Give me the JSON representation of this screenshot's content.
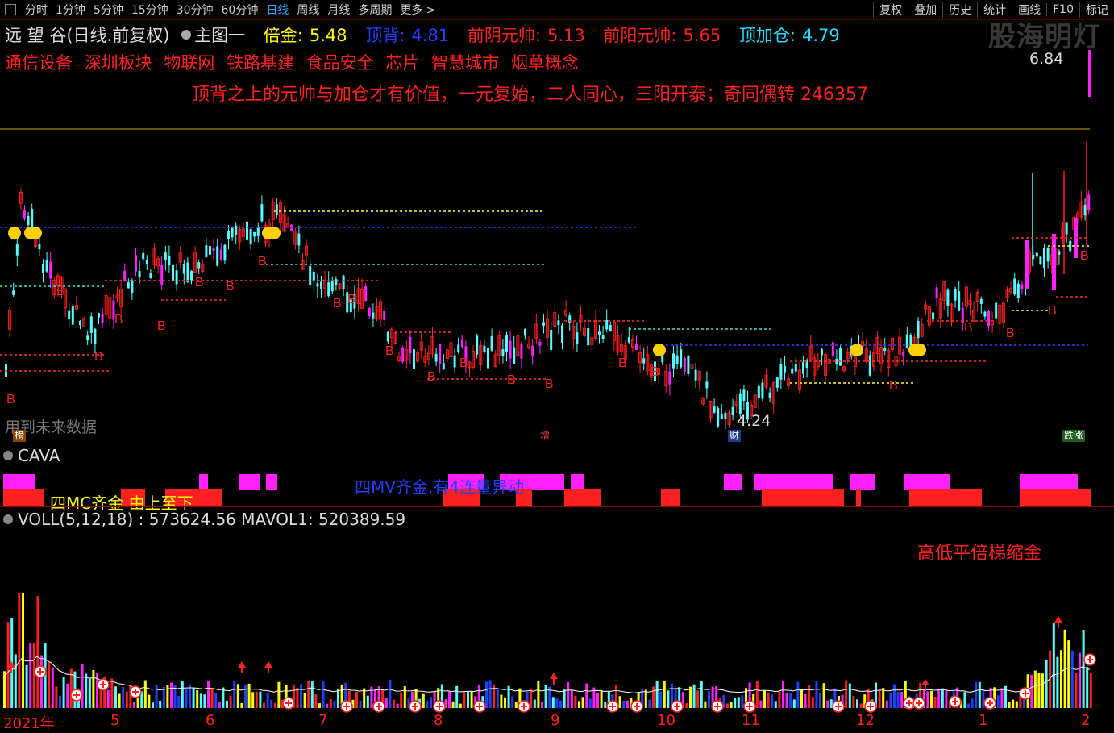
{
  "toolbar": {
    "items": [
      "分时",
      "1分钟",
      "5分钟",
      "15分钟",
      "30分钟",
      "60分钟",
      "日线",
      "周线",
      "月线",
      "多周期",
      "更多 >"
    ],
    "active": "日线",
    "right_items": [
      "复权",
      "叠加",
      "历史",
      "统计",
      "画线",
      "F10",
      "标记"
    ]
  },
  "watermark": "股海明灯",
  "header": {
    "stock": "远 望 谷(日线.前复权)",
    "main_chart": "主图一",
    "indicators": [
      {
        "label": "倍金:",
        "value": "5.48",
        "color": "#ffff00"
      },
      {
        "label": "顶背:",
        "value": "4.81",
        "color": "#2040ff"
      },
      {
        "label": "前阴元帅:",
        "value": "5.13",
        "color": "#ff2020"
      },
      {
        "label": "前阳元帅:",
        "value": "5.65",
        "color": "#ff2020"
      },
      {
        "label": "顶加仓:",
        "value": "4.79",
        "color": "#22ddff"
      }
    ]
  },
  "concepts": [
    "通信设备",
    "深圳板块",
    "物联网",
    "铁路基建",
    "食品安全",
    "芯片",
    "智慧城市",
    "烟草概念"
  ],
  "slogan": "顶背之上的元帅与加仓才有价值，一元复始，二人同心，三阳开泰；奇同偶转 246357",
  "price_high": "6.84",
  "price_low": "4.24",
  "future_data_note": "用到未来数据",
  "tags": [
    {
      "text": "榜",
      "bg": "#8b4500",
      "color": "#fff"
    },
    {
      "text": "增",
      "bg": "#000",
      "color": "#ff4040"
    },
    {
      "text": "财",
      "bg": "#1e3a8a",
      "color": "#fff"
    },
    {
      "text": "跌涨",
      "bg": "#1b5e20",
      "color": "#fff"
    }
  ],
  "cava": {
    "title": "CAVA",
    "text_mc": "四MC齐金 由上至下",
    "text_mv": "四MV齐金,有4连量异动"
  },
  "voll": {
    "title": "VOLL(5,12,18) : 573624.56  MAVOL1: 520389.59",
    "note": "高低平倍梯缩金"
  },
  "x_axis": [
    "2021年",
    "5",
    "6",
    "7",
    "8",
    "9",
    "10",
    "11",
    "12",
    "1",
    "2"
  ],
  "colors": {
    "up": "#ff2020",
    "down": "#54ffff",
    "magenta": "#ff22ff",
    "yellow": "#ffff00"
  }
}
